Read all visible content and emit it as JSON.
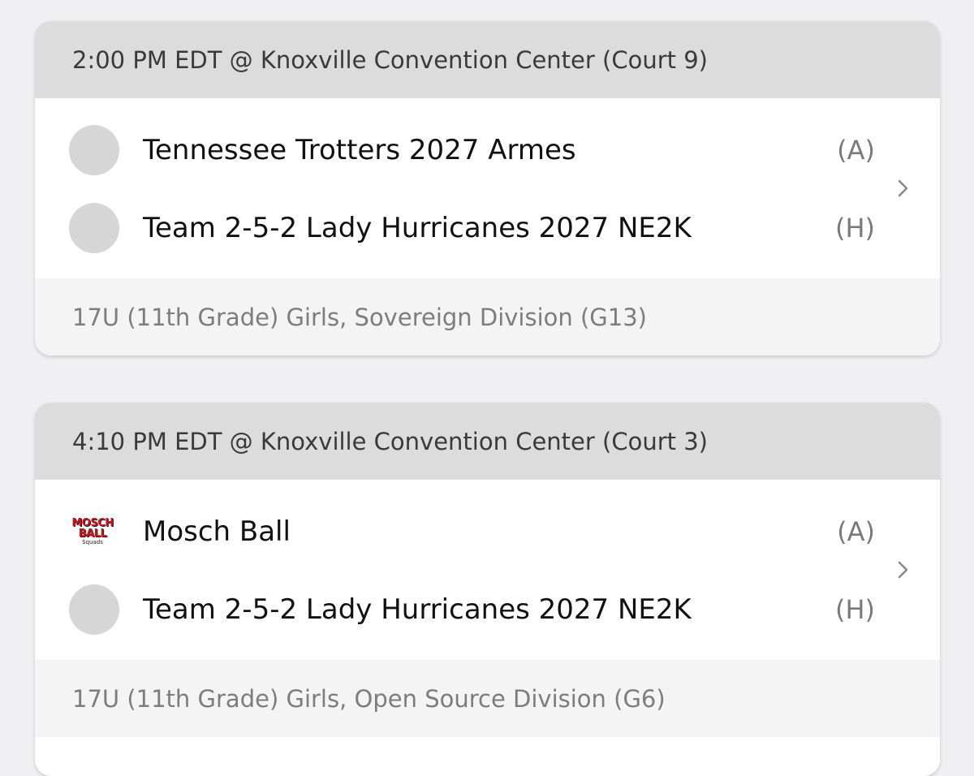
{
  "games": [
    {
      "header": "2:00 PM EDT @ Knoxville Convention Center (Court 9)",
      "teams": [
        {
          "name": "Tennessee Trotters 2027 Armes",
          "tag": "(A)",
          "icon": "placeholder-avatar"
        },
        {
          "name": "Team 2-5-2 Lady Hurricanes 2027 NE2K",
          "tag": "(H)",
          "icon": "placeholder-avatar"
        }
      ],
      "division": "17U (11th Grade) Girls, Sovereign Division (G13)"
    },
    {
      "header": "4:10 PM EDT @ Knoxville Convention Center (Court 3)",
      "teams": [
        {
          "name": "Mosch Ball",
          "tag": "(A)",
          "icon": "team-logo",
          "logo_text": [
            "MOSCH",
            "BALL",
            "Squads"
          ]
        },
        {
          "name": "Team 2-5-2 Lady Hurricanes 2027 NE2K",
          "tag": "(H)",
          "icon": "placeholder-avatar"
        }
      ],
      "division": "17U (11th Grade) Girls, Open Source Division (G6)"
    }
  ],
  "colors": {
    "background": "#f0f0f2",
    "header_bg": "#dcdcdc",
    "footer_bg": "#f4f4f4",
    "avatar_placeholder": "#d6d6d6",
    "logo_red": "#c8161d"
  }
}
